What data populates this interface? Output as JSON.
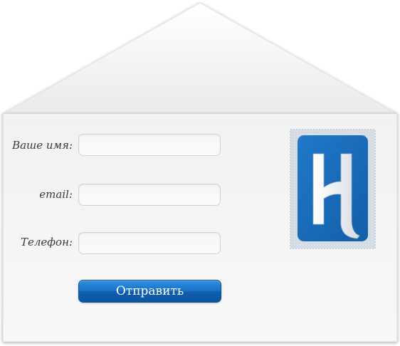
{
  "form": {
    "fields": [
      {
        "label": "Ваше имя:",
        "value": "",
        "placeholder": ""
      },
      {
        "label": "email:",
        "value": "",
        "placeholder": ""
      },
      {
        "label": "Телефон:",
        "value": "",
        "placeholder": ""
      }
    ],
    "submit_label": "Отправить"
  },
  "stamp": {
    "icon": "letter-h-logo-icon"
  },
  "colors": {
    "button_top": "#2d8ee0",
    "button_bottom": "#0b56a0",
    "stamp_blue": "#1a6bbd",
    "envelope": "#f4f4f4"
  }
}
